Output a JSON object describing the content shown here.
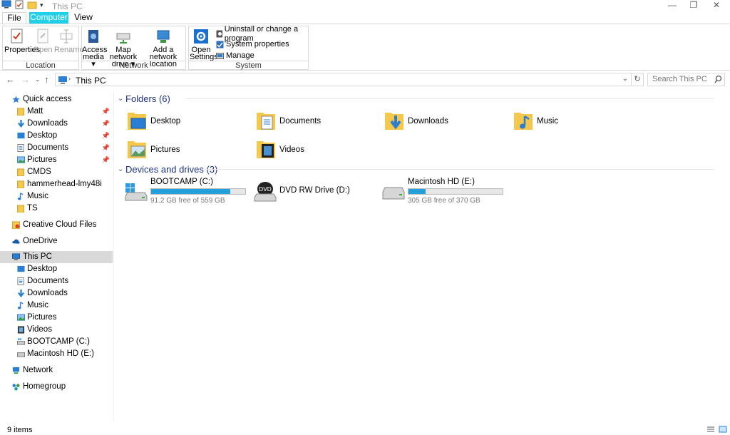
{
  "window": {
    "title": "This PC"
  },
  "ribbon_tabs": {
    "file": "File",
    "computer": "Computer",
    "view": "View"
  },
  "ribbon": {
    "location": {
      "label": "Location",
      "properties": "Properties",
      "open": "Open",
      "rename": "Rename"
    },
    "network": {
      "label": "Network",
      "access_media_1": "Access",
      "access_media_2": "media ▾",
      "map_drive_1": "Map network",
      "map_drive_2": "drive ▾",
      "add_location_1": "Add a network",
      "add_location_2": "location"
    },
    "system": {
      "label": "System",
      "open_settings_1": "Open",
      "open_settings_2": "Settings",
      "uninstall": "Uninstall or change a program",
      "system_properties": "System properties",
      "manage": "Manage"
    }
  },
  "address": {
    "path": "This PC",
    "search_placeholder": "Search This PC"
  },
  "sidebar": {
    "quick_access": "Quick access",
    "quick_items": [
      "Matt",
      "Downloads",
      "Desktop",
      "Documents",
      "Pictures",
      "CMDS",
      "hammerhead-lmy48i",
      "Music",
      "TS"
    ],
    "creative_cloud": "Creative Cloud Files",
    "onedrive": "OneDrive",
    "this_pc": "This PC",
    "pc_items": [
      "Desktop",
      "Documents",
      "Downloads",
      "Music",
      "Pictures",
      "Videos",
      "BOOTCAMP (C:)",
      "Macintosh HD (E:)"
    ],
    "network": "Network",
    "homegroup": "Homegroup"
  },
  "folders": {
    "header": "Folders (6)",
    "items": [
      "Desktop",
      "Documents",
      "Downloads",
      "Music",
      "Pictures",
      "Videos"
    ]
  },
  "drives": {
    "header": "Devices and drives (3)",
    "items": [
      {
        "name": "BOOTCAMP (C:)",
        "free": "91.2 GB free of 559 GB",
        "used_fraction": 0.84
      },
      {
        "name": "DVD RW Drive (D:)"
      },
      {
        "name": "Macintosh HD (E:)",
        "free": "305 GB free of 370 GB",
        "used_fraction": 0.18
      }
    ]
  },
  "status": {
    "items": "9 items"
  },
  "colors": {
    "accent": "#20d0e8",
    "folder": "#f5c84c",
    "header_text": "#1e3287",
    "drive_bar": "#26a0da"
  }
}
